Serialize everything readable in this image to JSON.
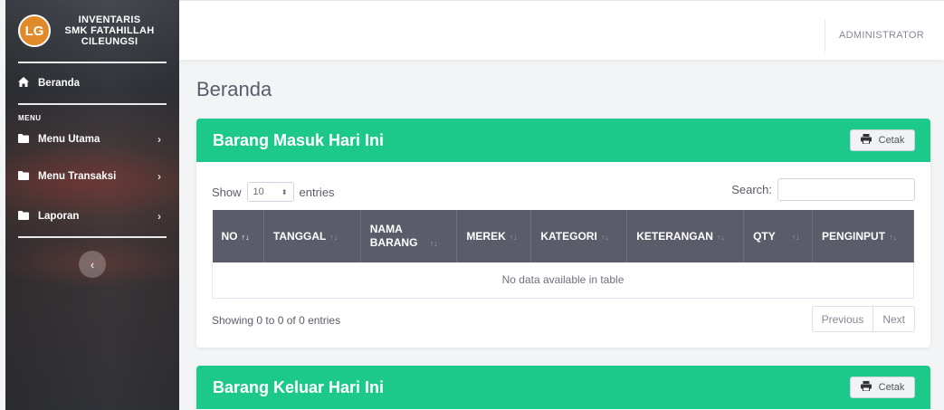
{
  "sidebar": {
    "brand": {
      "logo_text": "LG",
      "line1": "INVENTARIS",
      "line2": "SMK FATAHILLAH",
      "line3": "CILEUNGSI"
    },
    "home": {
      "label": "Beranda",
      "icon": "home-icon"
    },
    "menu_heading": "MENU",
    "items": [
      {
        "label": "Menu Utama",
        "icon": "folder-icon"
      },
      {
        "label": "Menu Transaksi",
        "icon": "folder-icon"
      },
      {
        "label": "Laporan",
        "icon": "folder-icon"
      }
    ],
    "toggle_icon": "chevron-left-icon"
  },
  "topbar": {
    "user": "ADMINISTRATOR"
  },
  "page": {
    "title": "Beranda"
  },
  "cards": [
    {
      "title": "Barang Masuk Hari Ini",
      "button": "Cetak",
      "show_label": "Show",
      "entries_label": "entries",
      "page_length": "10",
      "search_label": "Search:",
      "search_value": "",
      "columns": [
        "NO",
        "TANGGAL",
        "NAMA BARANG",
        "MEREK",
        "KATEGORI",
        "KETERANGAN",
        "QTY",
        "PENGINPUT"
      ],
      "empty_text": "No data available in table",
      "info": "Showing 0 to 0 of 0 entries",
      "prev": "Previous",
      "next": "Next"
    },
    {
      "title": "Barang Keluar Hari Ini",
      "button": "Cetak"
    }
  ],
  "colors": {
    "accent": "#1cc88a",
    "table_header": "#5a5c69"
  }
}
